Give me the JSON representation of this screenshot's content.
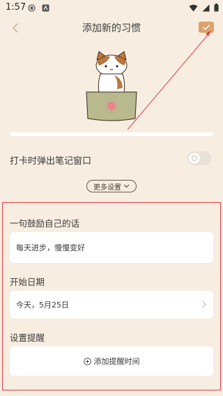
{
  "status_bar": {
    "time": "1:57"
  },
  "header": {
    "title": "添加新的习惯"
  },
  "settings": {
    "popup_note_label": "打卡时弹出笔记窗口",
    "more_settings_label": "更多设置"
  },
  "encourage": {
    "label": "一句鼓励自己的话",
    "value": "每天进步，慢慢变好"
  },
  "start_date": {
    "label": "开始日期",
    "value": "今天，5月25日"
  },
  "reminder": {
    "label": "设置提醒",
    "add_label": "添加提醒时间"
  },
  "colors": {
    "background": "#f7ede0",
    "confirm_button": "#dca26d",
    "annotation": "#e0404a"
  },
  "icons": [
    "back-icon",
    "check-icon",
    "toggle-knob-icon",
    "chevron-down-icon",
    "chevron-right-icon",
    "plus-circle-icon",
    "wifi-icon",
    "signal-icon",
    "battery-icon"
  ]
}
